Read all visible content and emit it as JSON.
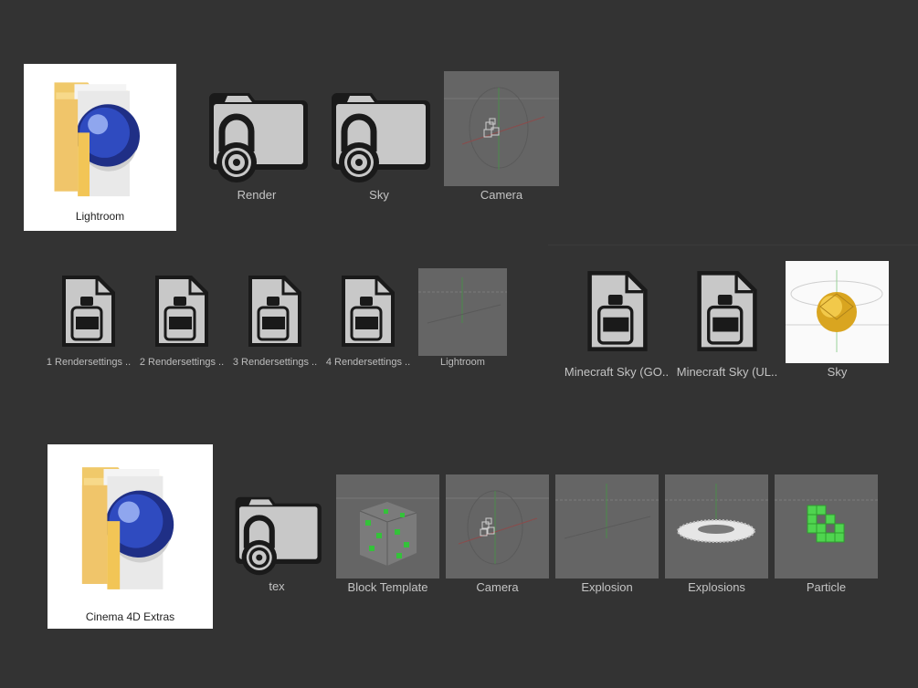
{
  "theme": {
    "background": "#333333",
    "tile": "#656565",
    "icon_fill": "#c8c8c8",
    "icon_stroke": "#1a1a1a",
    "label": "#c4c4c4"
  },
  "row1": {
    "lightroom_folder": {
      "label": "Lightroom",
      "icon": "cinema4d-folder-icon"
    },
    "render_folder": {
      "label": "Render",
      "icon": "locked-folder-icon"
    },
    "sky_folder": {
      "label": "Sky",
      "icon": "locked-folder-icon"
    },
    "camera_file": {
      "label": "Camera",
      "icon": "camera-scene-thumbnail"
    }
  },
  "row2": {
    "files": [
      {
        "label": "1 Rendersettings ..",
        "icon": "bottle-document-icon"
      },
      {
        "label": "2 Rendersettings ..",
        "icon": "bottle-document-icon"
      },
      {
        "label": "3 Rendersettings ..",
        "icon": "bottle-document-icon"
      },
      {
        "label": "4 Rendersettings ..",
        "icon": "bottle-document-icon"
      }
    ],
    "lightroom_scene": {
      "label": "Lightroom",
      "icon": "floor-scene-thumbnail"
    },
    "sky_files": [
      {
        "label": "Minecraft Sky (GO..",
        "icon": "bottle-document-icon"
      },
      {
        "label": "Minecraft Sky (UL..",
        "icon": "bottle-document-icon"
      }
    ],
    "sky_scene": {
      "label": "Sky",
      "icon": "gold-sphere-thumbnail"
    }
  },
  "row3": {
    "extras_folder": {
      "label": "Cinema 4D Extras",
      "icon": "cinema4d-folder-icon"
    },
    "tex_folder": {
      "label": "tex",
      "icon": "locked-folder-icon"
    },
    "scenes": [
      {
        "label": "Block Template",
        "icon": "block-cube-thumbnail"
      },
      {
        "label": "Camera",
        "icon": "camera-scene-thumbnail"
      },
      {
        "label": "Explosion",
        "icon": "floor-scene-thumbnail"
      },
      {
        "label": "Explosions",
        "icon": "ring-scene-thumbnail"
      },
      {
        "label": "Particle",
        "icon": "green-particle-thumbnail"
      }
    ]
  }
}
